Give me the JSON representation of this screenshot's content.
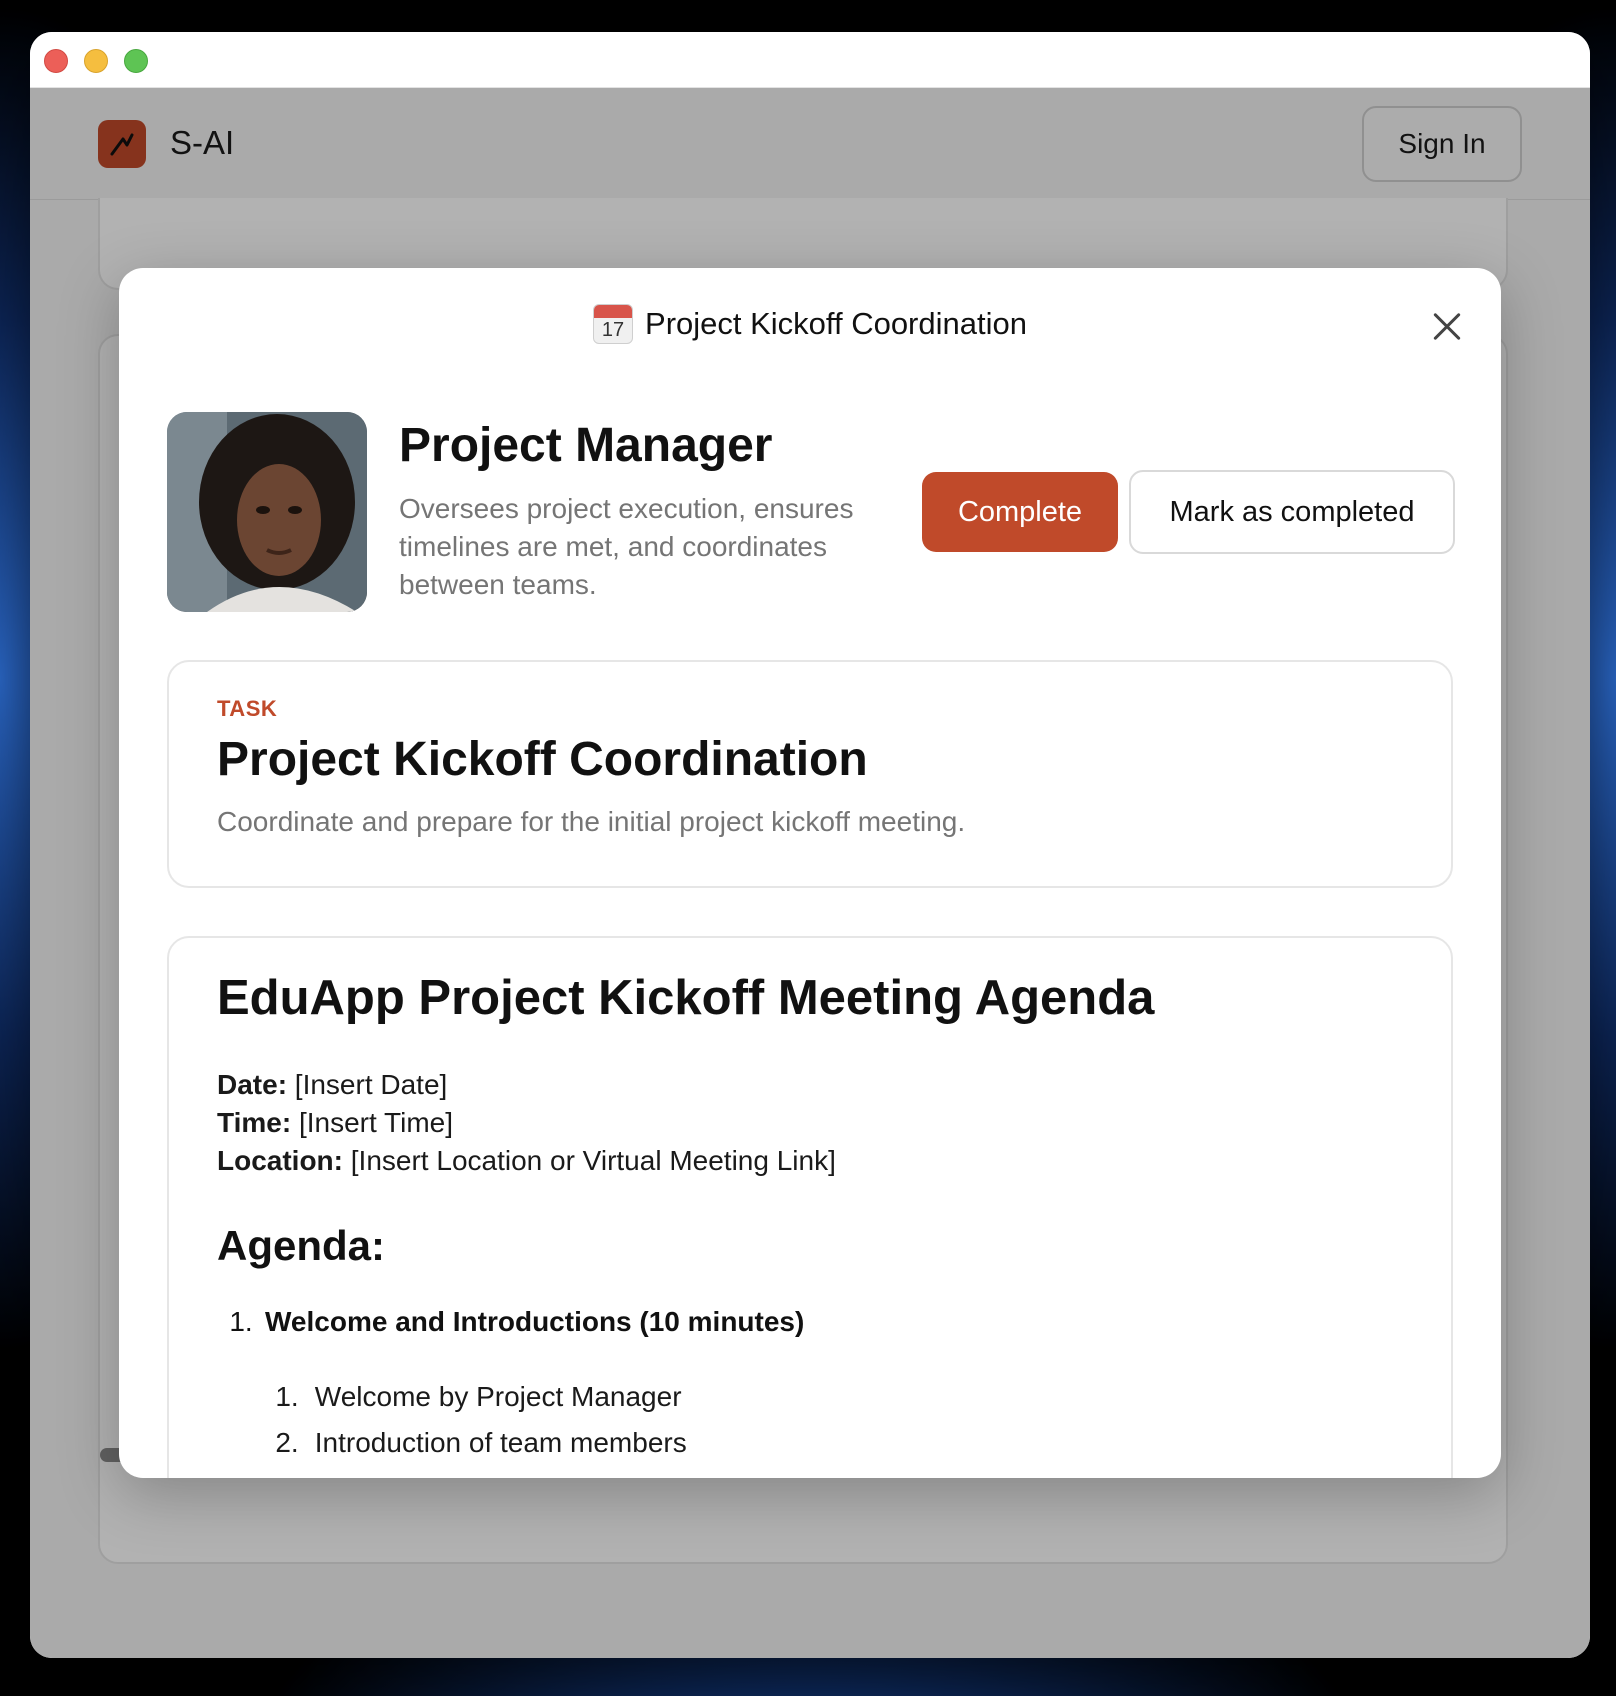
{
  "app": {
    "brand": "S-AI",
    "sign_in_label": "Sign In"
  },
  "modal": {
    "title": "Project Kickoff Coordination",
    "calendar_icon": {
      "month": "JUL",
      "day": "17"
    }
  },
  "role": {
    "title": "Project Manager",
    "description": "Oversees project execution, ensures timelines are met, and coordinates between teams.",
    "complete_label": "Complete",
    "mark_completed_label": "Mark as completed"
  },
  "task": {
    "eyebrow": "TASK",
    "title": "Project Kickoff Coordination",
    "description": "Coordinate and prepare for the initial project kickoff meeting."
  },
  "document": {
    "heading": "EduApp Project Kickoff Meeting Agenda",
    "meta": [
      {
        "label": "Date:",
        "value": " [Insert Date]"
      },
      {
        "label": "Time:",
        "value": " [Insert Time]"
      },
      {
        "label": "Location:",
        "value": " [Insert Location or Virtual Meeting Link]"
      }
    ],
    "agenda_heading": "Agenda:",
    "agenda": [
      {
        "number": "1.",
        "title": "Welcome and Introductions (10 minutes)",
        "subitems": [
          {
            "number": "1.",
            "text": "Welcome by Project Manager"
          },
          {
            "number": "2.",
            "text": "Introduction of team members"
          }
        ]
      }
    ]
  },
  "colors": {
    "accent": "#c04a2a",
    "muted_text": "#757575"
  }
}
